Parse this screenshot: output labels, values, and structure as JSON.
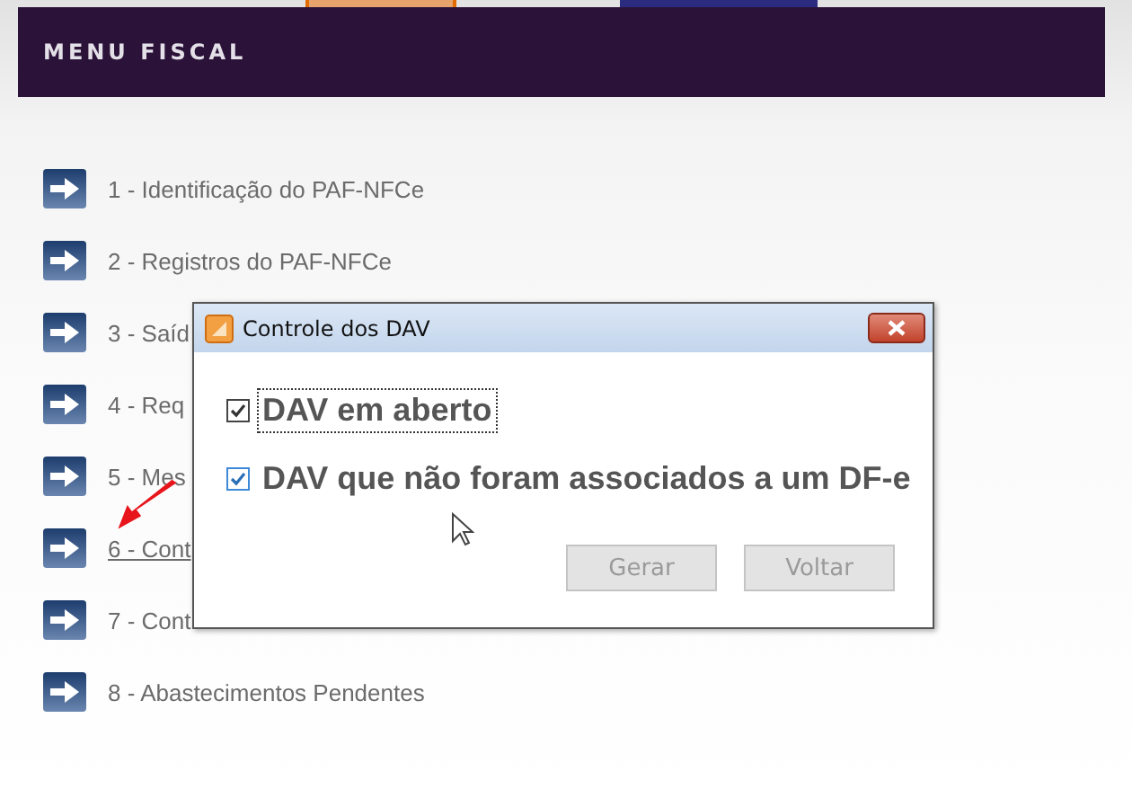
{
  "header": {
    "title": "MENU FISCAL"
  },
  "menu": [
    {
      "label": "1 - Identificação do PAF-NFCe",
      "hovered": false
    },
    {
      "label": "2 - Registros do PAF-NFCe",
      "hovered": false
    },
    {
      "label": "3 - Saíd",
      "hovered": false
    },
    {
      "label": "4 - Req",
      "hovered": false
    },
    {
      "label": "5 - Mes",
      "hovered": false
    },
    {
      "label": "6 - Cont",
      "hovered": true
    },
    {
      "label": "7 - Cont",
      "hovered": false
    },
    {
      "label": "8 - Abastecimentos Pendentes",
      "hovered": false
    }
  ],
  "dialog": {
    "title": "Controle dos DAV",
    "options": [
      {
        "label": "DAV em aberto",
        "checked": true,
        "focused": true
      },
      {
        "label": "DAV que não foram associados a um DF-e",
        "checked": true,
        "focused": false
      }
    ],
    "buttons": [
      {
        "label": "Gerar",
        "disabled": true
      },
      {
        "label": "Voltar",
        "disabled": true
      }
    ]
  }
}
